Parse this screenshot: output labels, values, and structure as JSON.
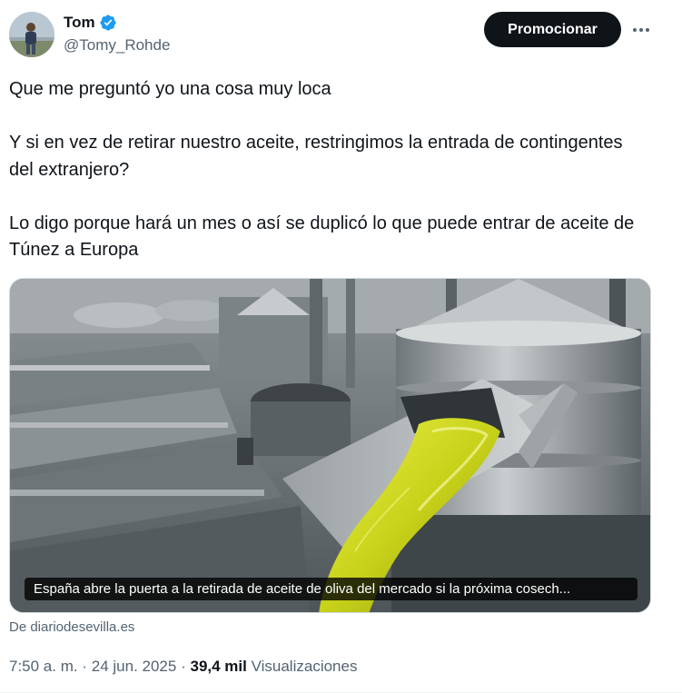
{
  "author": {
    "display_name": "Tom",
    "handle": "@Tomy_Rohde",
    "verified": true,
    "verified_color": "#1d9bf0"
  },
  "actions": {
    "promote_label": "Promocionar",
    "more_icon": "more-horizontal-icon"
  },
  "tweet": {
    "paragraphs": [
      "Que me preguntó yo una cosa muy loca",
      "Y si en vez de retirar nuestro aceite, restringimos la entrada de contingentes del extranjero?",
      "Lo digo porque hará un mes o así se duplicó lo que puede entrar de aceite de Túnez a Europa"
    ]
  },
  "card": {
    "caption": "España abre la puerta a la retirada de aceite de oliva del mercado si la próxima cosech...",
    "source": "De diariodesevilla.es"
  },
  "meta": {
    "time": "7:50 a. m.",
    "separator": "·",
    "date": "24 jun. 2025",
    "views_count": "39,4 mil",
    "views_label": "Visualizaciones"
  },
  "colors": {
    "text_primary": "#0f1419",
    "text_secondary": "#536471",
    "button_bg": "#0f1419",
    "oil": "#c8d21a"
  }
}
